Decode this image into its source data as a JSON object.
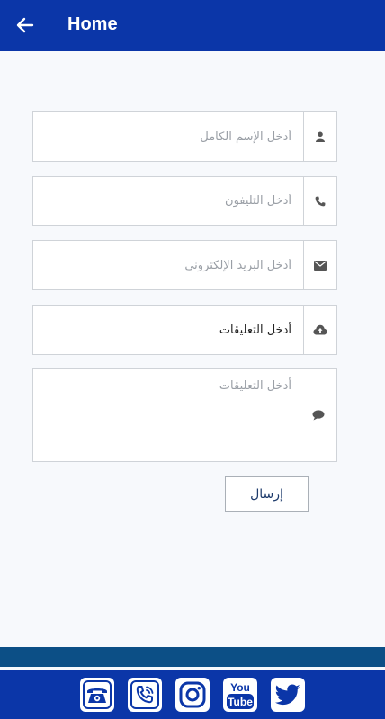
{
  "header": {
    "title": "Home"
  },
  "form": {
    "name_placeholder": "أدخل الإسم الكامل",
    "phone_placeholder": "أدخل التليفون",
    "email_placeholder": "أدخل البريد الإلكتروني",
    "upload_label": "أدخل التعليقات",
    "comments_placeholder": "أدخل التعليقات",
    "send_label": "إرسال"
  },
  "footer": {
    "youtube_text_top": "You",
    "youtube_text_bottom": "Tube",
    "icons": [
      "telephone-icon",
      "phone-call-icon",
      "instagram-icon",
      "youtube-icon",
      "twitter-icon"
    ]
  },
  "colors": {
    "appbar": "#0b36a8",
    "band": "#0c4f86",
    "background": "#f7f9fc"
  }
}
